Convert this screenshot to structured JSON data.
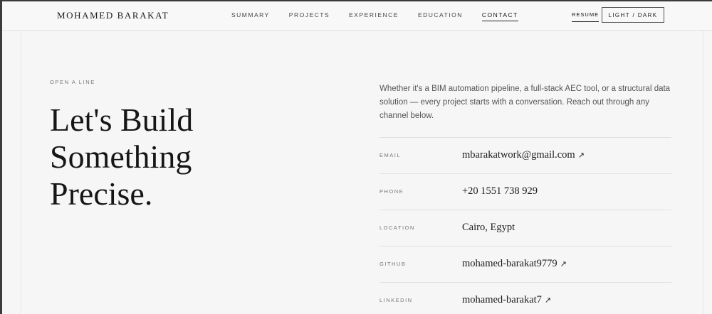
{
  "brand": "MOHAMED BARAKAT",
  "nav": [
    {
      "label": "SUMMARY",
      "active": false
    },
    {
      "label": "PROJECTS",
      "active": false
    },
    {
      "label": "EXPERIENCE",
      "active": false
    },
    {
      "label": "EDUCATION",
      "active": false
    },
    {
      "label": "CONTACT",
      "active": true
    }
  ],
  "resume_label": "RESUME",
  "theme_toggle_label": "LIGHT / DARK",
  "section": {
    "eyebrow": "OPEN A LINE",
    "headline": [
      "Let's Build",
      "Something",
      "Precise."
    ],
    "intro": "Whether it's a BIM automation pipeline, a full-stack AEC tool, or a structural data solution — every project starts with a conversation. Reach out through any channel below."
  },
  "contacts": [
    {
      "label": "EMAIL",
      "value": "mbarakatwork@gmail.com",
      "arrow": "↗"
    },
    {
      "label": "PHONE",
      "value": "+20 1551 738 929",
      "arrow": ""
    },
    {
      "label": "LOCATION",
      "value": "Cairo, Egypt",
      "arrow": ""
    },
    {
      "label": "GITHUB",
      "value": "mohamed-barakat9779",
      "arrow": "↗"
    },
    {
      "label": "LINKEDIN",
      "value": "mohamed-barakat7",
      "arrow": "↗"
    }
  ],
  "colors": {
    "background": "#f6f6f6",
    "text": "#1a1a1a",
    "muted": "#777777",
    "divider": "#e1e1e1"
  },
  "icons": {
    "external_link": "arrow-up-right-icon"
  }
}
